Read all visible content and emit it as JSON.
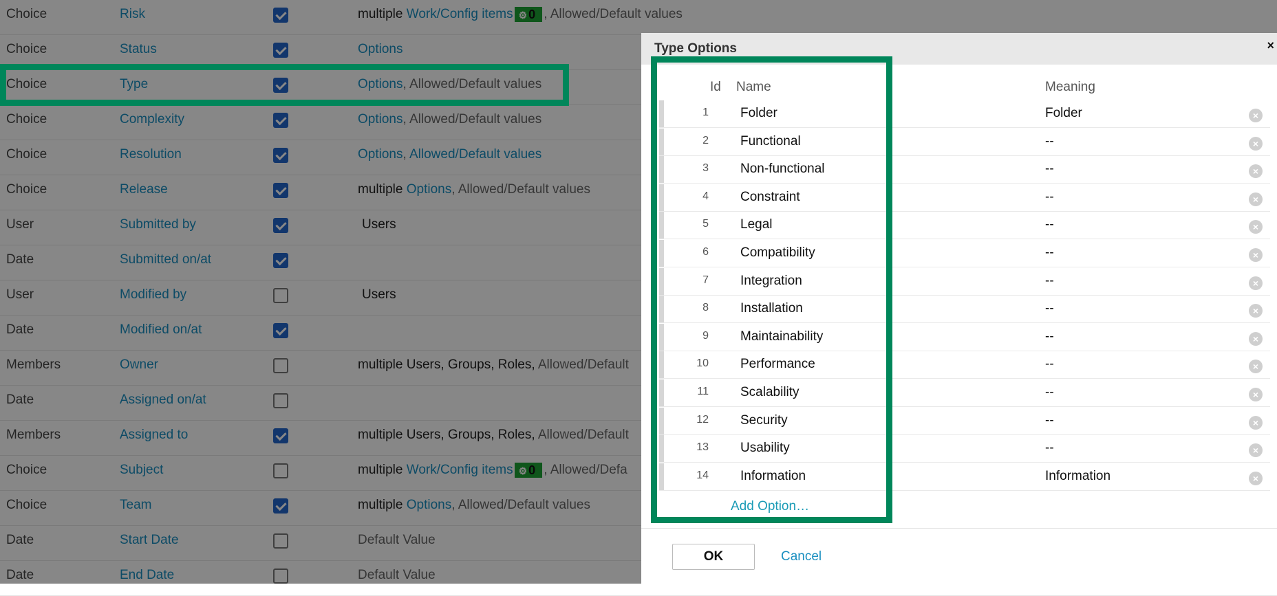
{
  "rows": [
    {
      "type": "Choice",
      "name": "Risk",
      "checked": true,
      "desc": [
        {
          "t": "multiple ",
          "c": "plain"
        },
        {
          "t": "Work/Config items",
          "c": "lnk"
        },
        {
          "badge": "0"
        },
        {
          "t": ", Allowed/Default values",
          "c": "gray"
        }
      ]
    },
    {
      "type": "Choice",
      "name": "Status",
      "checked": true,
      "desc": [
        {
          "t": "Options",
          "c": "lnk"
        }
      ]
    },
    {
      "type": "Choice",
      "name": "Type",
      "checked": true,
      "desc": [
        {
          "t": "Options",
          "c": "lnk"
        },
        {
          "t": ", Allowed/Default values",
          "c": "gray"
        }
      ]
    },
    {
      "type": "Choice",
      "name": "Complexity",
      "checked": true,
      "desc": [
        {
          "t": "Options",
          "c": "lnk"
        },
        {
          "t": ", Allowed/Default values",
          "c": "gray"
        }
      ]
    },
    {
      "type": "Choice",
      "name": "Resolution",
      "checked": true,
      "desc": [
        {
          "t": "Options",
          "c": "lnk"
        },
        {
          "t": ", ",
          "c": "gray"
        },
        {
          "t": "Allowed/Default values",
          "c": "lnk"
        }
      ]
    },
    {
      "type": "Choice",
      "name": "Release",
      "checked": true,
      "desc": [
        {
          "t": "multiple ",
          "c": "plain"
        },
        {
          "t": "Options",
          "c": "lnk"
        },
        {
          "t": ", Allowed/Default values",
          "c": "gray"
        }
      ]
    },
    {
      "type": "User",
      "name": "Submitted by",
      "checked": true,
      "indent": true,
      "desc": [
        {
          "t": "Users",
          "c": "plain"
        }
      ]
    },
    {
      "type": "Date",
      "name": "Submitted on/at",
      "checked": true,
      "desc": []
    },
    {
      "type": "User",
      "name": "Modified by",
      "checked": false,
      "indent": true,
      "desc": [
        {
          "t": "Users",
          "c": "plain"
        }
      ]
    },
    {
      "type": "Date",
      "name": "Modified on/at",
      "checked": true,
      "desc": []
    },
    {
      "type": "Members",
      "name": "Owner",
      "checked": false,
      "desc": [
        {
          "t": "multiple Users, Groups, Roles, ",
          "c": "plain"
        },
        {
          "t": "Allowed/Default",
          "c": "gray"
        }
      ]
    },
    {
      "type": "Date",
      "name": "Assigned on/at",
      "checked": false,
      "desc": []
    },
    {
      "type": "Members",
      "name": "Assigned to",
      "checked": true,
      "desc": [
        {
          "t": "multiple Users, Groups, Roles, ",
          "c": "plain"
        },
        {
          "t": "Allowed/Default",
          "c": "gray"
        }
      ]
    },
    {
      "type": "Choice",
      "name": "Subject",
      "checked": false,
      "desc": [
        {
          "t": "multiple ",
          "c": "plain"
        },
        {
          "t": "Work/Config items",
          "c": "lnk"
        },
        {
          "badge": "0"
        },
        {
          "t": ", Allowed/Defa",
          "c": "gray"
        }
      ]
    },
    {
      "type": "Choice",
      "name": "Team",
      "checked": true,
      "desc": [
        {
          "t": "multiple ",
          "c": "plain"
        },
        {
          "t": "Options",
          "c": "lnk"
        },
        {
          "t": ", Allowed/Default values",
          "c": "gray"
        }
      ]
    },
    {
      "type": "Date",
      "name": "Start Date",
      "checked": false,
      "desc": [
        {
          "t": "Default Value",
          "c": "gray"
        }
      ]
    },
    {
      "type": "Date",
      "name": "End Date",
      "checked": false,
      "desc": [
        {
          "t": "Default Value",
          "c": "gray"
        }
      ]
    }
  ],
  "dialog": {
    "title": "Type Options",
    "close_icon": "×",
    "col_id": "Id",
    "col_name": "Name",
    "col_meaning": "Meaning",
    "options": [
      {
        "id": "1",
        "name": "Folder",
        "meaning": "Folder"
      },
      {
        "id": "2",
        "name": "Functional",
        "meaning": "--"
      },
      {
        "id": "3",
        "name": "Non-functional",
        "meaning": "--"
      },
      {
        "id": "4",
        "name": "Constraint",
        "meaning": "--"
      },
      {
        "id": "5",
        "name": "Legal",
        "meaning": "--"
      },
      {
        "id": "6",
        "name": "Compatibility",
        "meaning": "--"
      },
      {
        "id": "7",
        "name": "Integration",
        "meaning": "--"
      },
      {
        "id": "8",
        "name": "Installation",
        "meaning": "--"
      },
      {
        "id": "9",
        "name": "Maintainability",
        "meaning": "--"
      },
      {
        "id": "10",
        "name": "Performance",
        "meaning": "--"
      },
      {
        "id": "11",
        "name": "Scalability",
        "meaning": "--"
      },
      {
        "id": "12",
        "name": "Security",
        "meaning": "--"
      },
      {
        "id": "13",
        "name": "Usability",
        "meaning": "--"
      },
      {
        "id": "14",
        "name": "Information",
        "meaning": "Information"
      }
    ],
    "add_option": "Add Option…",
    "ok_label": "OK",
    "cancel_label": "Cancel"
  },
  "colors": {
    "highlight": "#00865a",
    "link": "#1a8fc0",
    "checkbox": "#2266cc",
    "badge": "#1ea233"
  }
}
